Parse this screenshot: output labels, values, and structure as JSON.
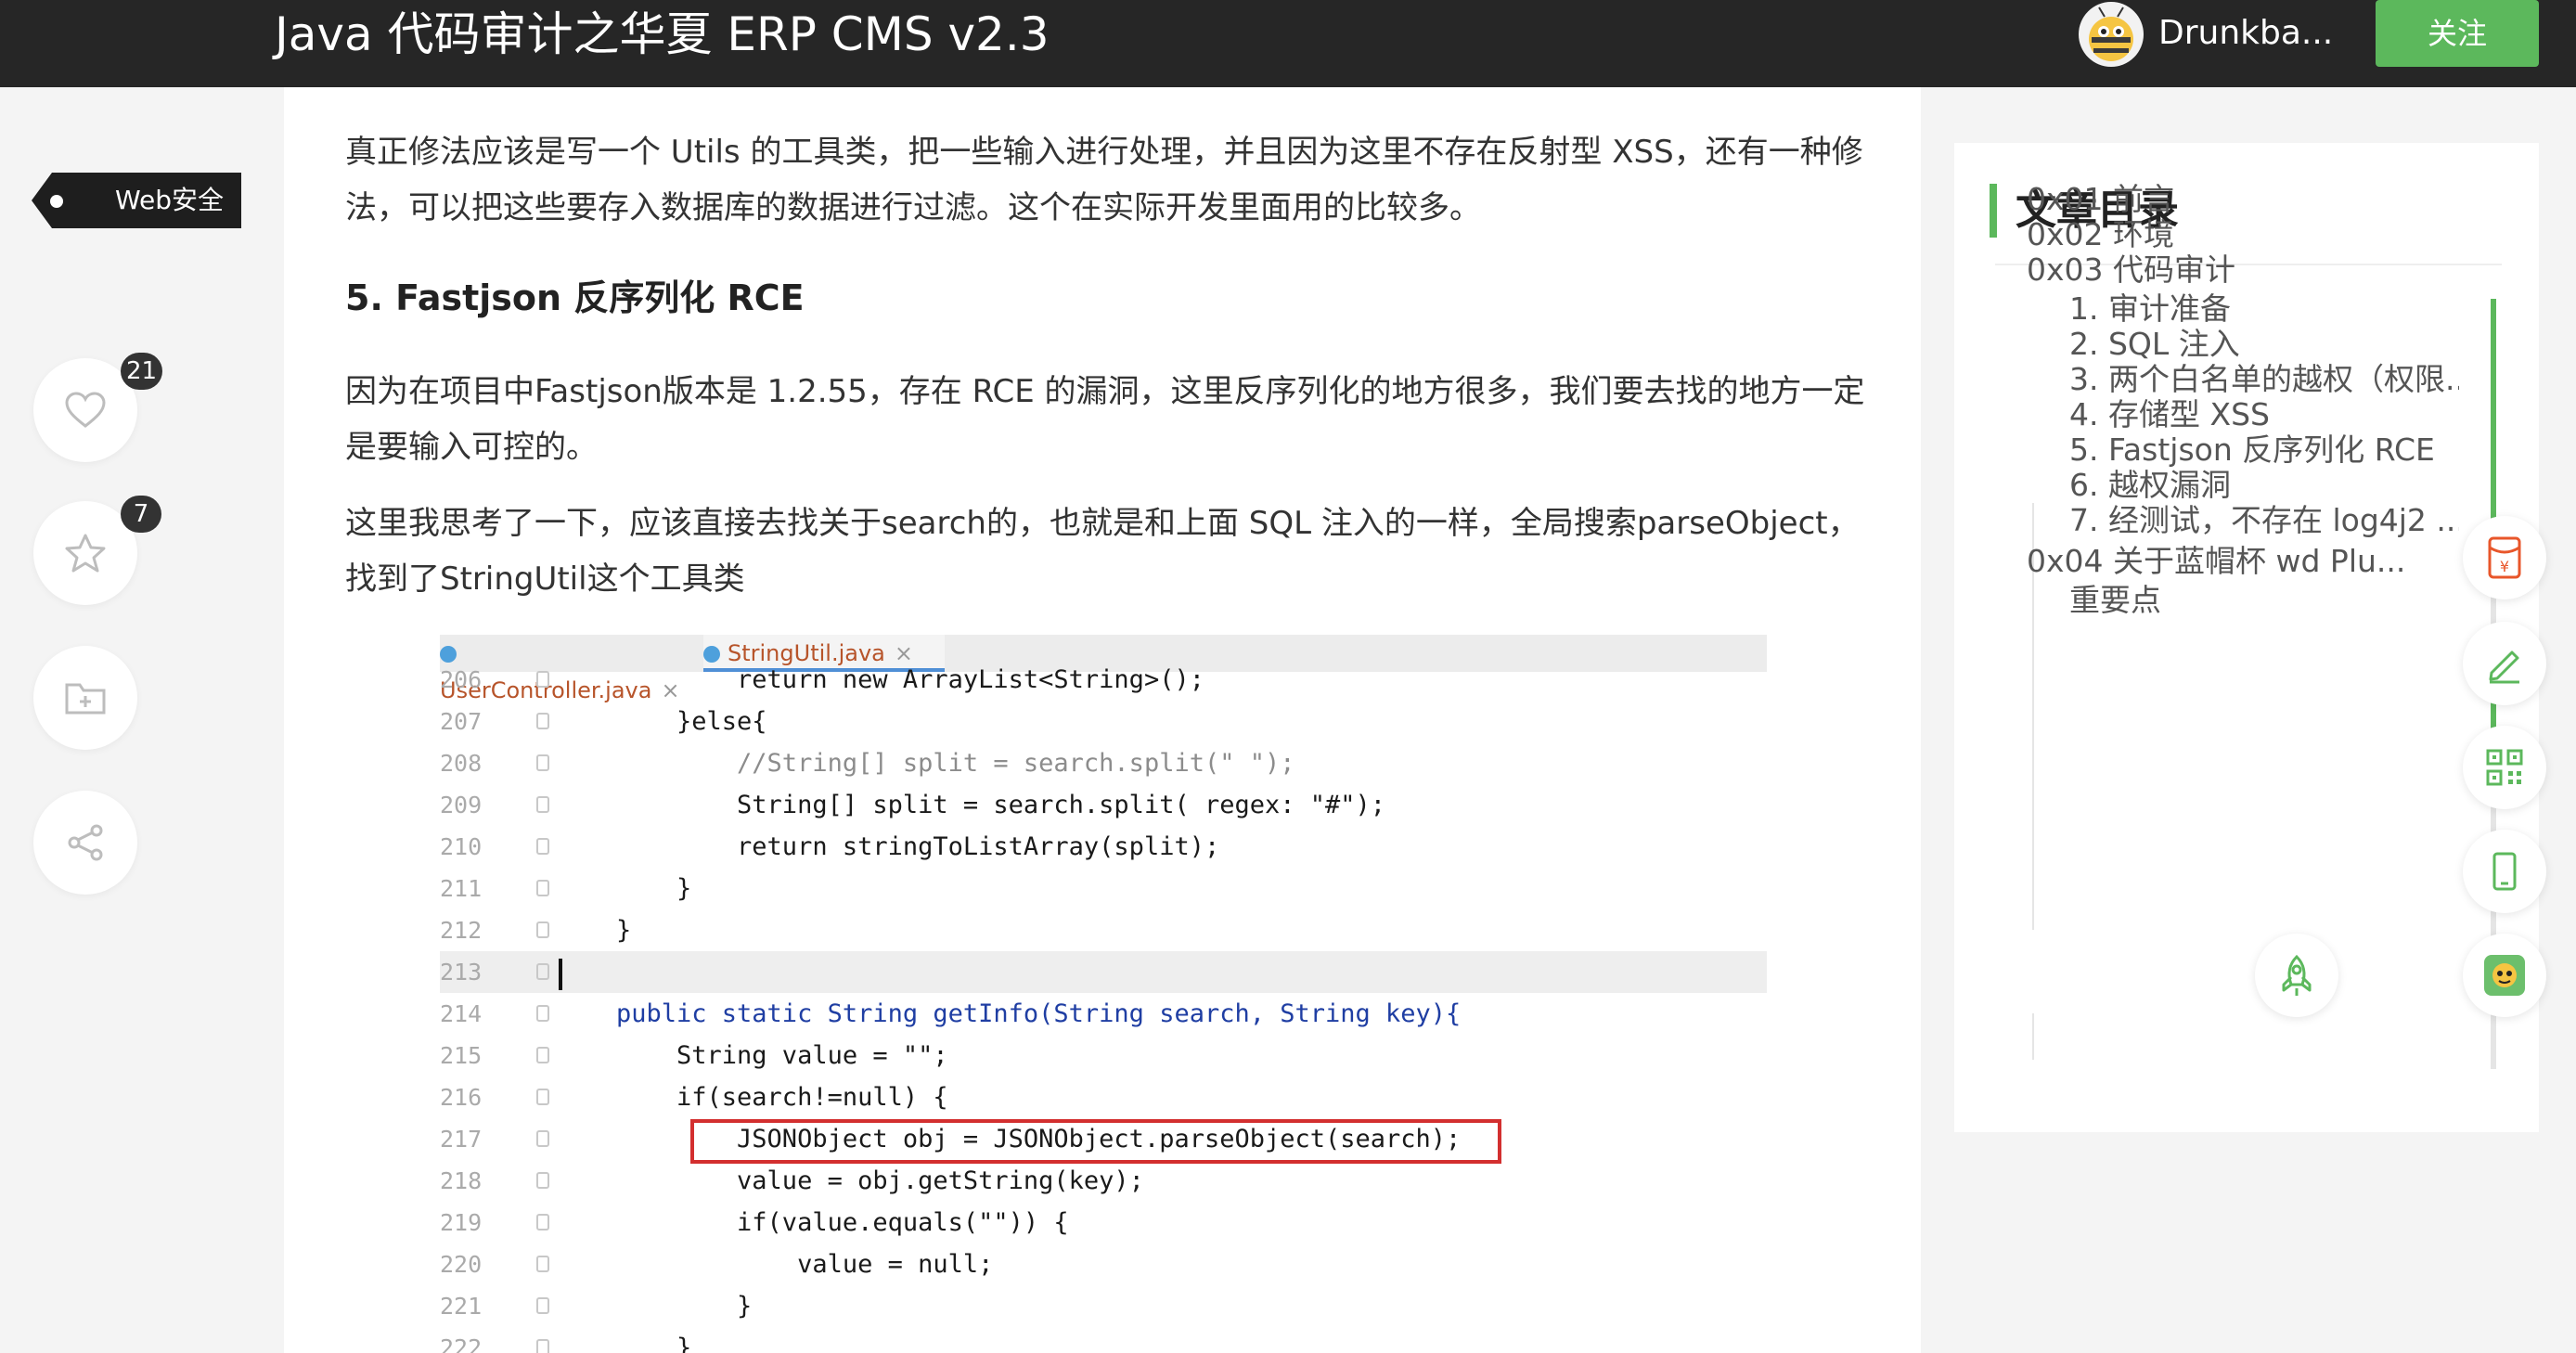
{
  "header": {
    "title": "Java 代码审计之华夏 ERP CMS v2.3",
    "username": "Drunkba...",
    "follow_label": "关注"
  },
  "sidebar": {
    "tag_label": "Web安全",
    "like_count": "21",
    "favorite_count": "7"
  },
  "article": {
    "para1": "真正修法应该是写一个 Utils 的工具类，把一些输入进行处理，并且因为这里不存在反射型 XSS，还有一种修法，可以把这些要存入数据库的数据进行过滤。这个在实际开发里面用的比较多。",
    "heading": "5. Fastjson 反序列化 RCE",
    "para2": "因为在项目中Fastjson版本是 1.2.55，存在 RCE 的漏洞，这里反序列化的地方很多，我们要去找的地方一定是要输入可控的。",
    "para3": "这里我思考了一下，应该直接去找关于search的，也就是和上面 SQL 注入的一样，全局搜索parseObject，找到了StringUtil这个工具类"
  },
  "code_screenshot": {
    "tabs": [
      "UserController.java",
      "StringUtil.java"
    ],
    "lines": [
      {
        "num": "206",
        "code": "        return new ArrayList<String>();"
      },
      {
        "num": "207",
        "code": "    }else{"
      },
      {
        "num": "208",
        "code": "        //String[] split = search.split(\" \");"
      },
      {
        "num": "209",
        "code": "        String[] split = search.split( regex: \"#\");"
      },
      {
        "num": "210",
        "code": "        return stringToListArray(split);"
      },
      {
        "num": "211",
        "code": "    }"
      },
      {
        "num": "212",
        "code": "}"
      },
      {
        "num": "213",
        "code": ""
      },
      {
        "num": "214",
        "code": "public static String getInfo(String search, String key){"
      },
      {
        "num": "215",
        "code": "    String value = \"\";"
      },
      {
        "num": "216",
        "code": "    if(search!=null) {"
      },
      {
        "num": "217",
        "code": "        JSONObject obj = JSONObject.parseObject(search);"
      },
      {
        "num": "218",
        "code": "        value = obj.getString(key);"
      },
      {
        "num": "219",
        "code": "        if(value.equals(\"\")) {"
      },
      {
        "num": "220",
        "code": "            value = null;"
      },
      {
        "num": "221",
        "code": "        }"
      },
      {
        "num": "222",
        "code": "    }"
      }
    ]
  },
  "toc": {
    "title": "文章目录",
    "items": [
      {
        "label": "0x01 前言",
        "level": 1
      },
      {
        "label": "0x02 环境",
        "level": 1
      },
      {
        "label": "0x03 代码审计",
        "level": 1
      },
      {
        "label": "1. 审计准备",
        "level": 2
      },
      {
        "label": "2. SQL 注入",
        "level": 2
      },
      {
        "label": "3. 两个白名单的越权（权限...",
        "level": 2
      },
      {
        "label": "4. 存储型 XSS",
        "level": 2
      },
      {
        "label": "5. Fastjson 反序列化 RCE",
        "level": 2
      },
      {
        "label": "6. 越权漏洞",
        "level": 2
      },
      {
        "label": "7. 经测试，不存在 log4j2 ...",
        "level": 2
      },
      {
        "label": "0x04 关于蓝帽杯 wd Plu...",
        "level": 1
      },
      {
        "label": "重要点",
        "level": 2
      }
    ]
  },
  "colors": {
    "header_bg": "#262626",
    "accent_green": "#5cb85c",
    "highlight_red": "#d32f2f",
    "tool_red": "#e8562a"
  }
}
